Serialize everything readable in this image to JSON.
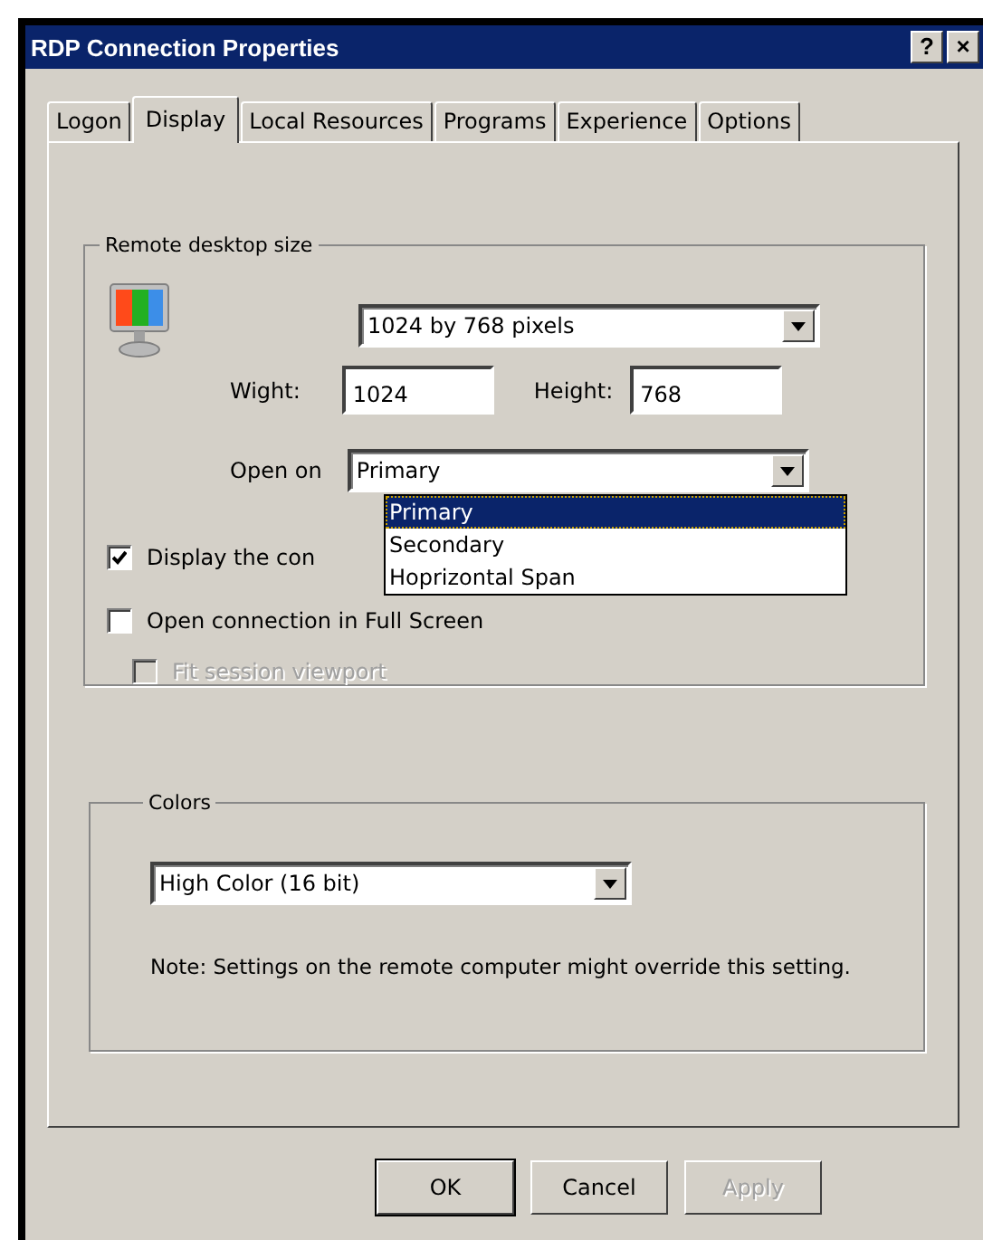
{
  "window": {
    "title": "RDP Connection Properties",
    "title_buttons": [
      "?",
      "×"
    ]
  },
  "tabs": [
    {
      "label": "Logon",
      "selected": false
    },
    {
      "label": "Display",
      "selected": true
    },
    {
      "label": "Local Resources",
      "selected": false
    },
    {
      "label": "Programs",
      "selected": false
    },
    {
      "label": "Experience",
      "selected": false
    },
    {
      "label": "Options",
      "selected": false
    }
  ],
  "remote_desktop_size": {
    "legend": "Remote desktop size",
    "resolution": "1024 by 768 pixels",
    "width_label": "Wight:",
    "width_value": "1024",
    "height_label": "Height:",
    "height_value": "768",
    "open_on_label": "Open on",
    "open_on_value": "Primary",
    "open_on_options": [
      {
        "label": "Primary",
        "selected": true
      },
      {
        "label": "Secondary",
        "selected": false
      },
      {
        "label": "Hoprizontal Span",
        "selected": false
      }
    ],
    "checkboxes": [
      {
        "label": "Display the con",
        "checked": true,
        "disabled": false
      },
      {
        "label": "Open connection in Full Screen",
        "checked": false,
        "disabled": false
      },
      {
        "label": "Fit session viewport",
        "checked": false,
        "disabled": true
      }
    ]
  },
  "colors": {
    "legend": "Colors",
    "value": "High Color (16 bit)",
    "note": "Note: Settings on the remote computer  might override this setting."
  },
  "buttons": [
    {
      "label": "OK",
      "disabled": false,
      "default": true
    },
    {
      "label": "Cancel",
      "disabled": false,
      "default": false
    },
    {
      "label": "Apply",
      "disabled": true,
      "default": false
    }
  ]
}
